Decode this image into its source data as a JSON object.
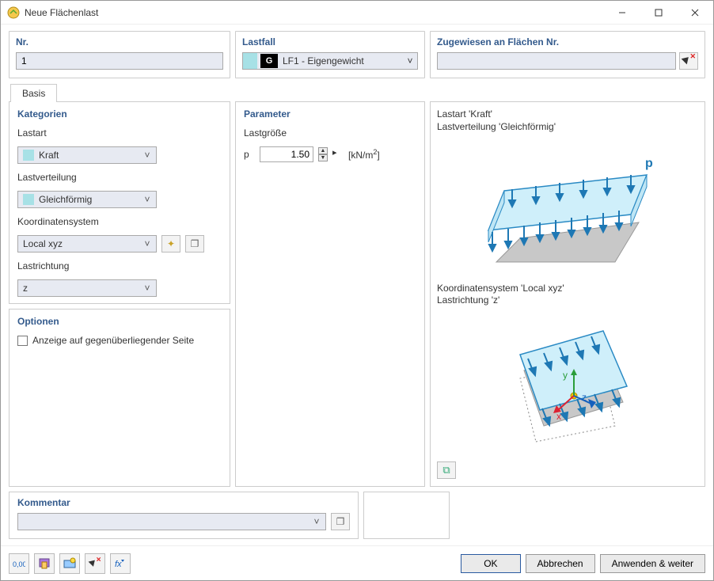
{
  "titlebar": {
    "title": "Neue Flächenlast"
  },
  "top": {
    "nr": {
      "title": "Nr.",
      "value": "1"
    },
    "loadcase": {
      "title": "Lastfall",
      "badge": "G",
      "label": "LF1 - Eigengewicht"
    },
    "assigned": {
      "title": "Zugewiesen an Flächen Nr.",
      "value": ""
    }
  },
  "tabs": {
    "basis": "Basis"
  },
  "categories": {
    "title": "Kategorien",
    "lastart_label": "Lastart",
    "lastart_value": "Kraft",
    "lastverteilung_label": "Lastverteilung",
    "lastverteilung_value": "Gleichförmig",
    "koord_label": "Koordinatensystem",
    "koord_value": "Local xyz",
    "richtung_label": "Lastrichtung",
    "richtung_value": "z"
  },
  "options": {
    "title": "Optionen",
    "opposite": "Anzeige auf gegenüberliegender Seite"
  },
  "parameter": {
    "title": "Parameter",
    "size_label": "Lastgröße",
    "symbol": "p",
    "value": "1.50",
    "unit_html": "[kN/m²]"
  },
  "graphics": {
    "caption1a": "Lastart 'Kraft'",
    "caption1b": "Lastverteilung 'Gleichförmig'",
    "p_label": "p",
    "caption2a": "Koordinatensystem 'Local xyz'",
    "caption2b": "Lastrichtung 'z'",
    "axis_x": "x",
    "axis_y": "y",
    "axis_z": "z"
  },
  "comment": {
    "title": "Kommentar",
    "value": ""
  },
  "buttons": {
    "ok": "OK",
    "cancel": "Abbrechen",
    "apply": "Anwenden & weiter"
  }
}
